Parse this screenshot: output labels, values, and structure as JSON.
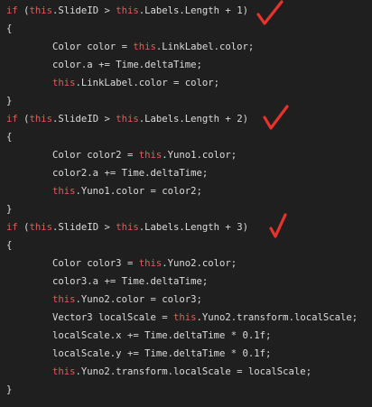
{
  "code_lines": [
    [
      {
        "t": "if",
        "c": "kw"
      },
      {
        "t": " (",
        "c": "plain"
      },
      {
        "t": "this",
        "c": "this"
      },
      {
        "t": ".SlideID ",
        "c": "plain"
      },
      {
        "t": ">",
        "c": "op"
      },
      {
        "t": " ",
        "c": "plain"
      },
      {
        "t": "this",
        "c": "this"
      },
      {
        "t": ".Labels.Length ",
        "c": "plain"
      },
      {
        "t": "+",
        "c": "op"
      },
      {
        "t": " 1)",
        "c": "plain"
      }
    ],
    [
      {
        "t": "{",
        "c": "plain"
      }
    ],
    [
      {
        "t": "        Color color ",
        "c": "plain"
      },
      {
        "t": "=",
        "c": "op"
      },
      {
        "t": " ",
        "c": "plain"
      },
      {
        "t": "this",
        "c": "this"
      },
      {
        "t": ".LinkLabel.color;",
        "c": "plain"
      }
    ],
    [
      {
        "t": "        color.a ",
        "c": "plain"
      },
      {
        "t": "+=",
        "c": "op"
      },
      {
        "t": " Time.deltaTime;",
        "c": "plain"
      }
    ],
    [
      {
        "t": "        ",
        "c": "plain"
      },
      {
        "t": "this",
        "c": "this"
      },
      {
        "t": ".LinkLabel.color ",
        "c": "plain"
      },
      {
        "t": "=",
        "c": "op"
      },
      {
        "t": " color;",
        "c": "plain"
      }
    ],
    [
      {
        "t": "}",
        "c": "plain"
      }
    ],
    [
      {
        "t": "if",
        "c": "kw"
      },
      {
        "t": " (",
        "c": "plain"
      },
      {
        "t": "this",
        "c": "this"
      },
      {
        "t": ".SlideID ",
        "c": "plain"
      },
      {
        "t": ">",
        "c": "op"
      },
      {
        "t": " ",
        "c": "plain"
      },
      {
        "t": "this",
        "c": "this"
      },
      {
        "t": ".Labels.Length ",
        "c": "plain"
      },
      {
        "t": "+",
        "c": "op"
      },
      {
        "t": " 2)",
        "c": "plain"
      }
    ],
    [
      {
        "t": "{",
        "c": "plain"
      }
    ],
    [
      {
        "t": "        Color color2 ",
        "c": "plain"
      },
      {
        "t": "=",
        "c": "op"
      },
      {
        "t": " ",
        "c": "plain"
      },
      {
        "t": "this",
        "c": "this"
      },
      {
        "t": ".Yuno1.color;",
        "c": "plain"
      }
    ],
    [
      {
        "t": "        color2.a ",
        "c": "plain"
      },
      {
        "t": "+=",
        "c": "op"
      },
      {
        "t": " Time.deltaTime;",
        "c": "plain"
      }
    ],
    [
      {
        "t": "        ",
        "c": "plain"
      },
      {
        "t": "this",
        "c": "this"
      },
      {
        "t": ".Yuno1.color ",
        "c": "plain"
      },
      {
        "t": "=",
        "c": "op"
      },
      {
        "t": " color2;",
        "c": "plain"
      }
    ],
    [
      {
        "t": "}",
        "c": "plain"
      }
    ],
    [
      {
        "t": "if",
        "c": "kw"
      },
      {
        "t": " (",
        "c": "plain"
      },
      {
        "t": "this",
        "c": "this"
      },
      {
        "t": ".SlideID ",
        "c": "plain"
      },
      {
        "t": ">",
        "c": "op"
      },
      {
        "t": " ",
        "c": "plain"
      },
      {
        "t": "this",
        "c": "this"
      },
      {
        "t": ".Labels.Length ",
        "c": "plain"
      },
      {
        "t": "+",
        "c": "op"
      },
      {
        "t": " 3)",
        "c": "plain"
      }
    ],
    [
      {
        "t": "{",
        "c": "plain"
      }
    ],
    [
      {
        "t": "        Color color3 ",
        "c": "plain"
      },
      {
        "t": "=",
        "c": "op"
      },
      {
        "t": " ",
        "c": "plain"
      },
      {
        "t": "this",
        "c": "this"
      },
      {
        "t": ".Yuno2.color;",
        "c": "plain"
      }
    ],
    [
      {
        "t": "        color3.a ",
        "c": "plain"
      },
      {
        "t": "+=",
        "c": "op"
      },
      {
        "t": " Time.deltaTime;",
        "c": "plain"
      }
    ],
    [
      {
        "t": "        ",
        "c": "plain"
      },
      {
        "t": "this",
        "c": "this"
      },
      {
        "t": ".Yuno2.color ",
        "c": "plain"
      },
      {
        "t": "=",
        "c": "op"
      },
      {
        "t": " color3;",
        "c": "plain"
      }
    ],
    [
      {
        "t": "        Vector3 localScale ",
        "c": "plain"
      },
      {
        "t": "=",
        "c": "op"
      },
      {
        "t": " ",
        "c": "plain"
      },
      {
        "t": "this",
        "c": "this"
      },
      {
        "t": ".Yuno2.transform.localScale;",
        "c": "plain"
      }
    ],
    [
      {
        "t": "        localScale.x ",
        "c": "plain"
      },
      {
        "t": "+=",
        "c": "op"
      },
      {
        "t": " Time.deltaTime ",
        "c": "plain"
      },
      {
        "t": "*",
        "c": "op"
      },
      {
        "t": " 0.1f;",
        "c": "plain"
      }
    ],
    [
      {
        "t": "        localScale.y ",
        "c": "plain"
      },
      {
        "t": "+=",
        "c": "op"
      },
      {
        "t": " Time.deltaTime ",
        "c": "plain"
      },
      {
        "t": "*",
        "c": "op"
      },
      {
        "t": " 0.1f;",
        "c": "plain"
      }
    ],
    [
      {
        "t": "        ",
        "c": "plain"
      },
      {
        "t": "this",
        "c": "this"
      },
      {
        "t": ".Yuno2.transform.localScale ",
        "c": "plain"
      },
      {
        "t": "=",
        "c": "op"
      },
      {
        "t": " localScale;",
        "c": "plain"
      }
    ],
    [
      {
        "t": "}",
        "c": "plain"
      }
    ]
  ],
  "colors": {
    "background": "#1f1f1f",
    "keyword": "#e35b5b",
    "text": "#dcdcdc",
    "annotation": "#e8322b"
  },
  "annotations": [
    {
      "icon": "red-checkmark-icon",
      "line": 1
    },
    {
      "icon": "red-checkmark-icon",
      "line": 7
    },
    {
      "icon": "red-checkmark-icon",
      "line": 13
    }
  ]
}
